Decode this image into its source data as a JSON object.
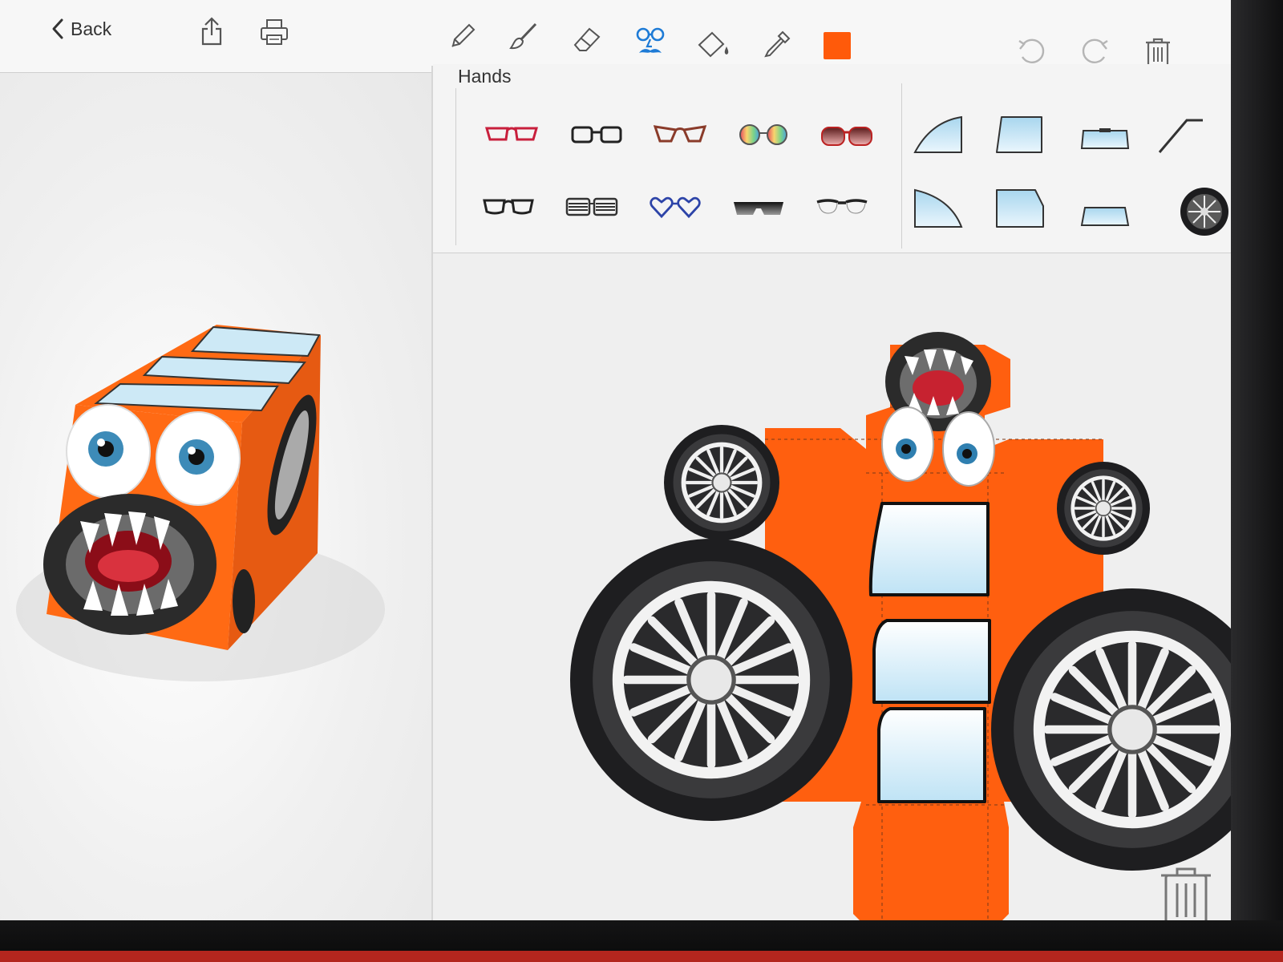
{
  "toolbar": {
    "back_label": "Back",
    "active_tool": "stickers",
    "selected_color": "#ff5a0a"
  },
  "stickers": {
    "category_title": "Hands",
    "glasses": [
      {
        "icon": "red-cat-eye-glasses-icon"
      },
      {
        "icon": "black-rectangle-glasses-icon"
      },
      {
        "icon": "brown-cat-eye-glasses-icon"
      },
      {
        "icon": "rainbow-round-glasses-icon"
      },
      {
        "icon": "red-gradient-sunglasses-icon"
      },
      {
        "icon": "black-frame-glasses-icon"
      },
      {
        "icon": "shutter-shades-glasses-icon"
      },
      {
        "icon": "blue-heart-glasses-icon"
      },
      {
        "icon": "black-shield-sunglasses-icon"
      },
      {
        "icon": "browline-glasses-icon"
      }
    ],
    "car_parts": [
      {
        "icon": "front-window-left-icon"
      },
      {
        "icon": "side-window-icon"
      },
      {
        "icon": "rear-window-icon"
      },
      {
        "icon": "wiper-icon"
      },
      {
        "icon": "front-window-right-icon"
      },
      {
        "icon": "side-window-2-icon"
      },
      {
        "icon": "rear-window-2-icon"
      },
      {
        "icon": "wheel-icon"
      }
    ]
  },
  "colors": {
    "accent_blue": "#1e7bd6",
    "body_orange": "#ff5a0a",
    "window_blue": "#bfe3f5"
  }
}
